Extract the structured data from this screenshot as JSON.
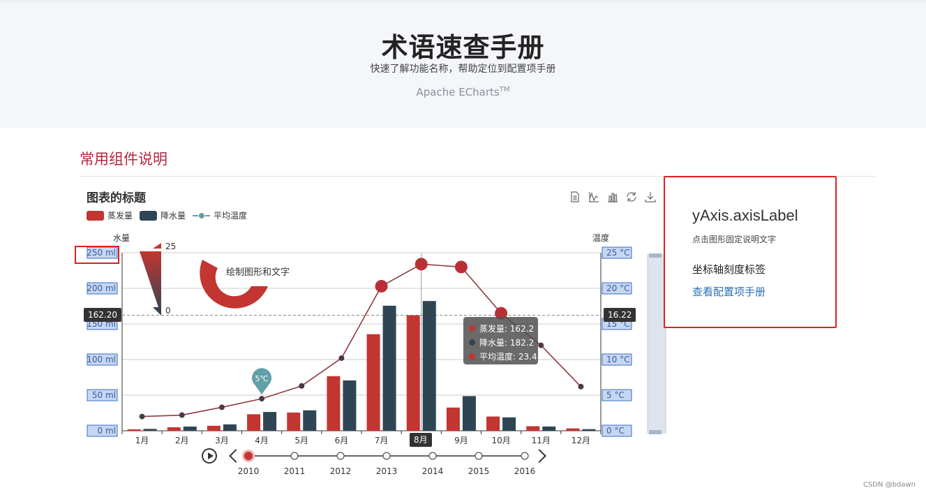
{
  "hero": {
    "title": "术语速查手册",
    "subtitle": "快速了解功能名称，帮助定位到配置项手册",
    "brand": "Apache ECharts",
    "brand_tm": "TM"
  },
  "section": {
    "title": "常用组件说明"
  },
  "chart_title": "图表的标题",
  "legend": [
    {
      "label": "蒸发量",
      "color": "#c23531"
    },
    {
      "label": "降水量",
      "color": "#2f4554"
    },
    {
      "label": "平均温度",
      "color": "#61a0a8"
    }
  ],
  "toolbox": [
    "data-view-icon",
    "line-chart-icon",
    "bar-chart-icon",
    "restore-icon",
    "save-image-icon"
  ],
  "axis_names": {
    "left": "水量",
    "right": "温度"
  },
  "visual_map": {
    "max": "25",
    "min": "0"
  },
  "graphic_text": "绘制图形和文字",
  "markpoint": "5℃",
  "axis_pointer": {
    "left": "162.20",
    "right": "16.22",
    "x": "8月"
  },
  "tooltip": [
    {
      "label": "蒸发量: 162.2",
      "color": "#c23531"
    },
    {
      "label": "降水量: 182.2",
      "color": "#2f4554"
    },
    {
      "label": "平均温度: 23.4",
      "color": "#c23531"
    }
  ],
  "chart_data": {
    "type": "bar",
    "categories": [
      "1月",
      "2月",
      "3月",
      "4月",
      "5月",
      "6月",
      "7月",
      "8月",
      "9月",
      "10月",
      "11月",
      "12月"
    ],
    "series": [
      {
        "name": "蒸发量",
        "type": "bar",
        "color": "#c23531",
        "values": [
          2.0,
          4.9,
          7.0,
          23.2,
          25.6,
          76.7,
          135.6,
          162.2,
          32.6,
          20.0,
          6.4,
          3.3
        ]
      },
      {
        "name": "降水量",
        "type": "bar",
        "color": "#2f4554",
        "values": [
          2.6,
          5.9,
          9.0,
          26.4,
          28.7,
          70.7,
          175.6,
          182.2,
          48.7,
          18.8,
          6.0,
          2.3
        ]
      },
      {
        "name": "平均温度",
        "type": "line",
        "color": "#61a0a8",
        "values": [
          2.0,
          2.2,
          3.3,
          4.5,
          6.3,
          10.2,
          20.3,
          23.4,
          23.0,
          16.5,
          12.0,
          6.2
        ]
      }
    ],
    "y_left": {
      "ticks": [
        "0 ml",
        "50 ml",
        "100 ml",
        "150 ml",
        "200 ml",
        "250 ml"
      ],
      "range": [
        0,
        250
      ]
    },
    "y_right": {
      "ticks": [
        "0 °C",
        "5 °C",
        "10 °C",
        "15 °C",
        "20 °C",
        "25 °C"
      ],
      "range": [
        0,
        25
      ]
    },
    "timeline": [
      "2010",
      "2011",
      "2012",
      "2013",
      "2014",
      "2015",
      "2016"
    ],
    "timeline_current": "2010",
    "grid": true,
    "legend_position": "top-left"
  },
  "side_panel": {
    "title": "yAxis.axisLabel",
    "desc": "点击图形固定说明文字",
    "label": "坐标轴刻度标签",
    "link": "查看配置项手册"
  },
  "watermark": "CSDN @bdawn"
}
